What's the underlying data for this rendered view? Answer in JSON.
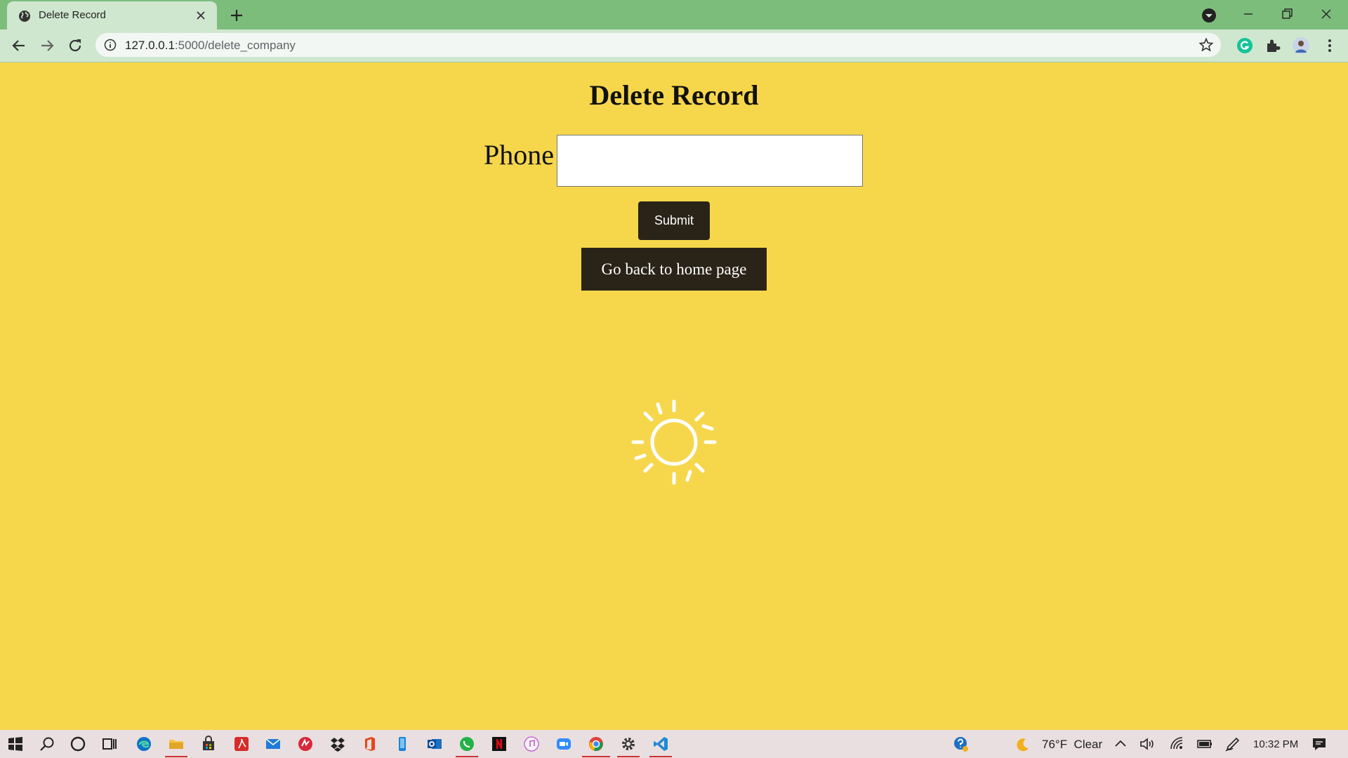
{
  "browser": {
    "tab_title": "Delete Record",
    "url_host": "127.0.0.1",
    "url_path": ":5000/delete_company"
  },
  "page": {
    "heading": "Delete Record",
    "phone_label": "Phone",
    "phone_value": "",
    "submit_label": "Submit",
    "home_link_label": "Go back to home page"
  },
  "taskbar": {
    "temperature": "76°F",
    "weather_text": "Clear",
    "clock": "10:32 PM"
  },
  "colors": {
    "page_background": "#f6d74b",
    "button_background": "#2a2418",
    "tab_strip": "#7cbd7b"
  }
}
